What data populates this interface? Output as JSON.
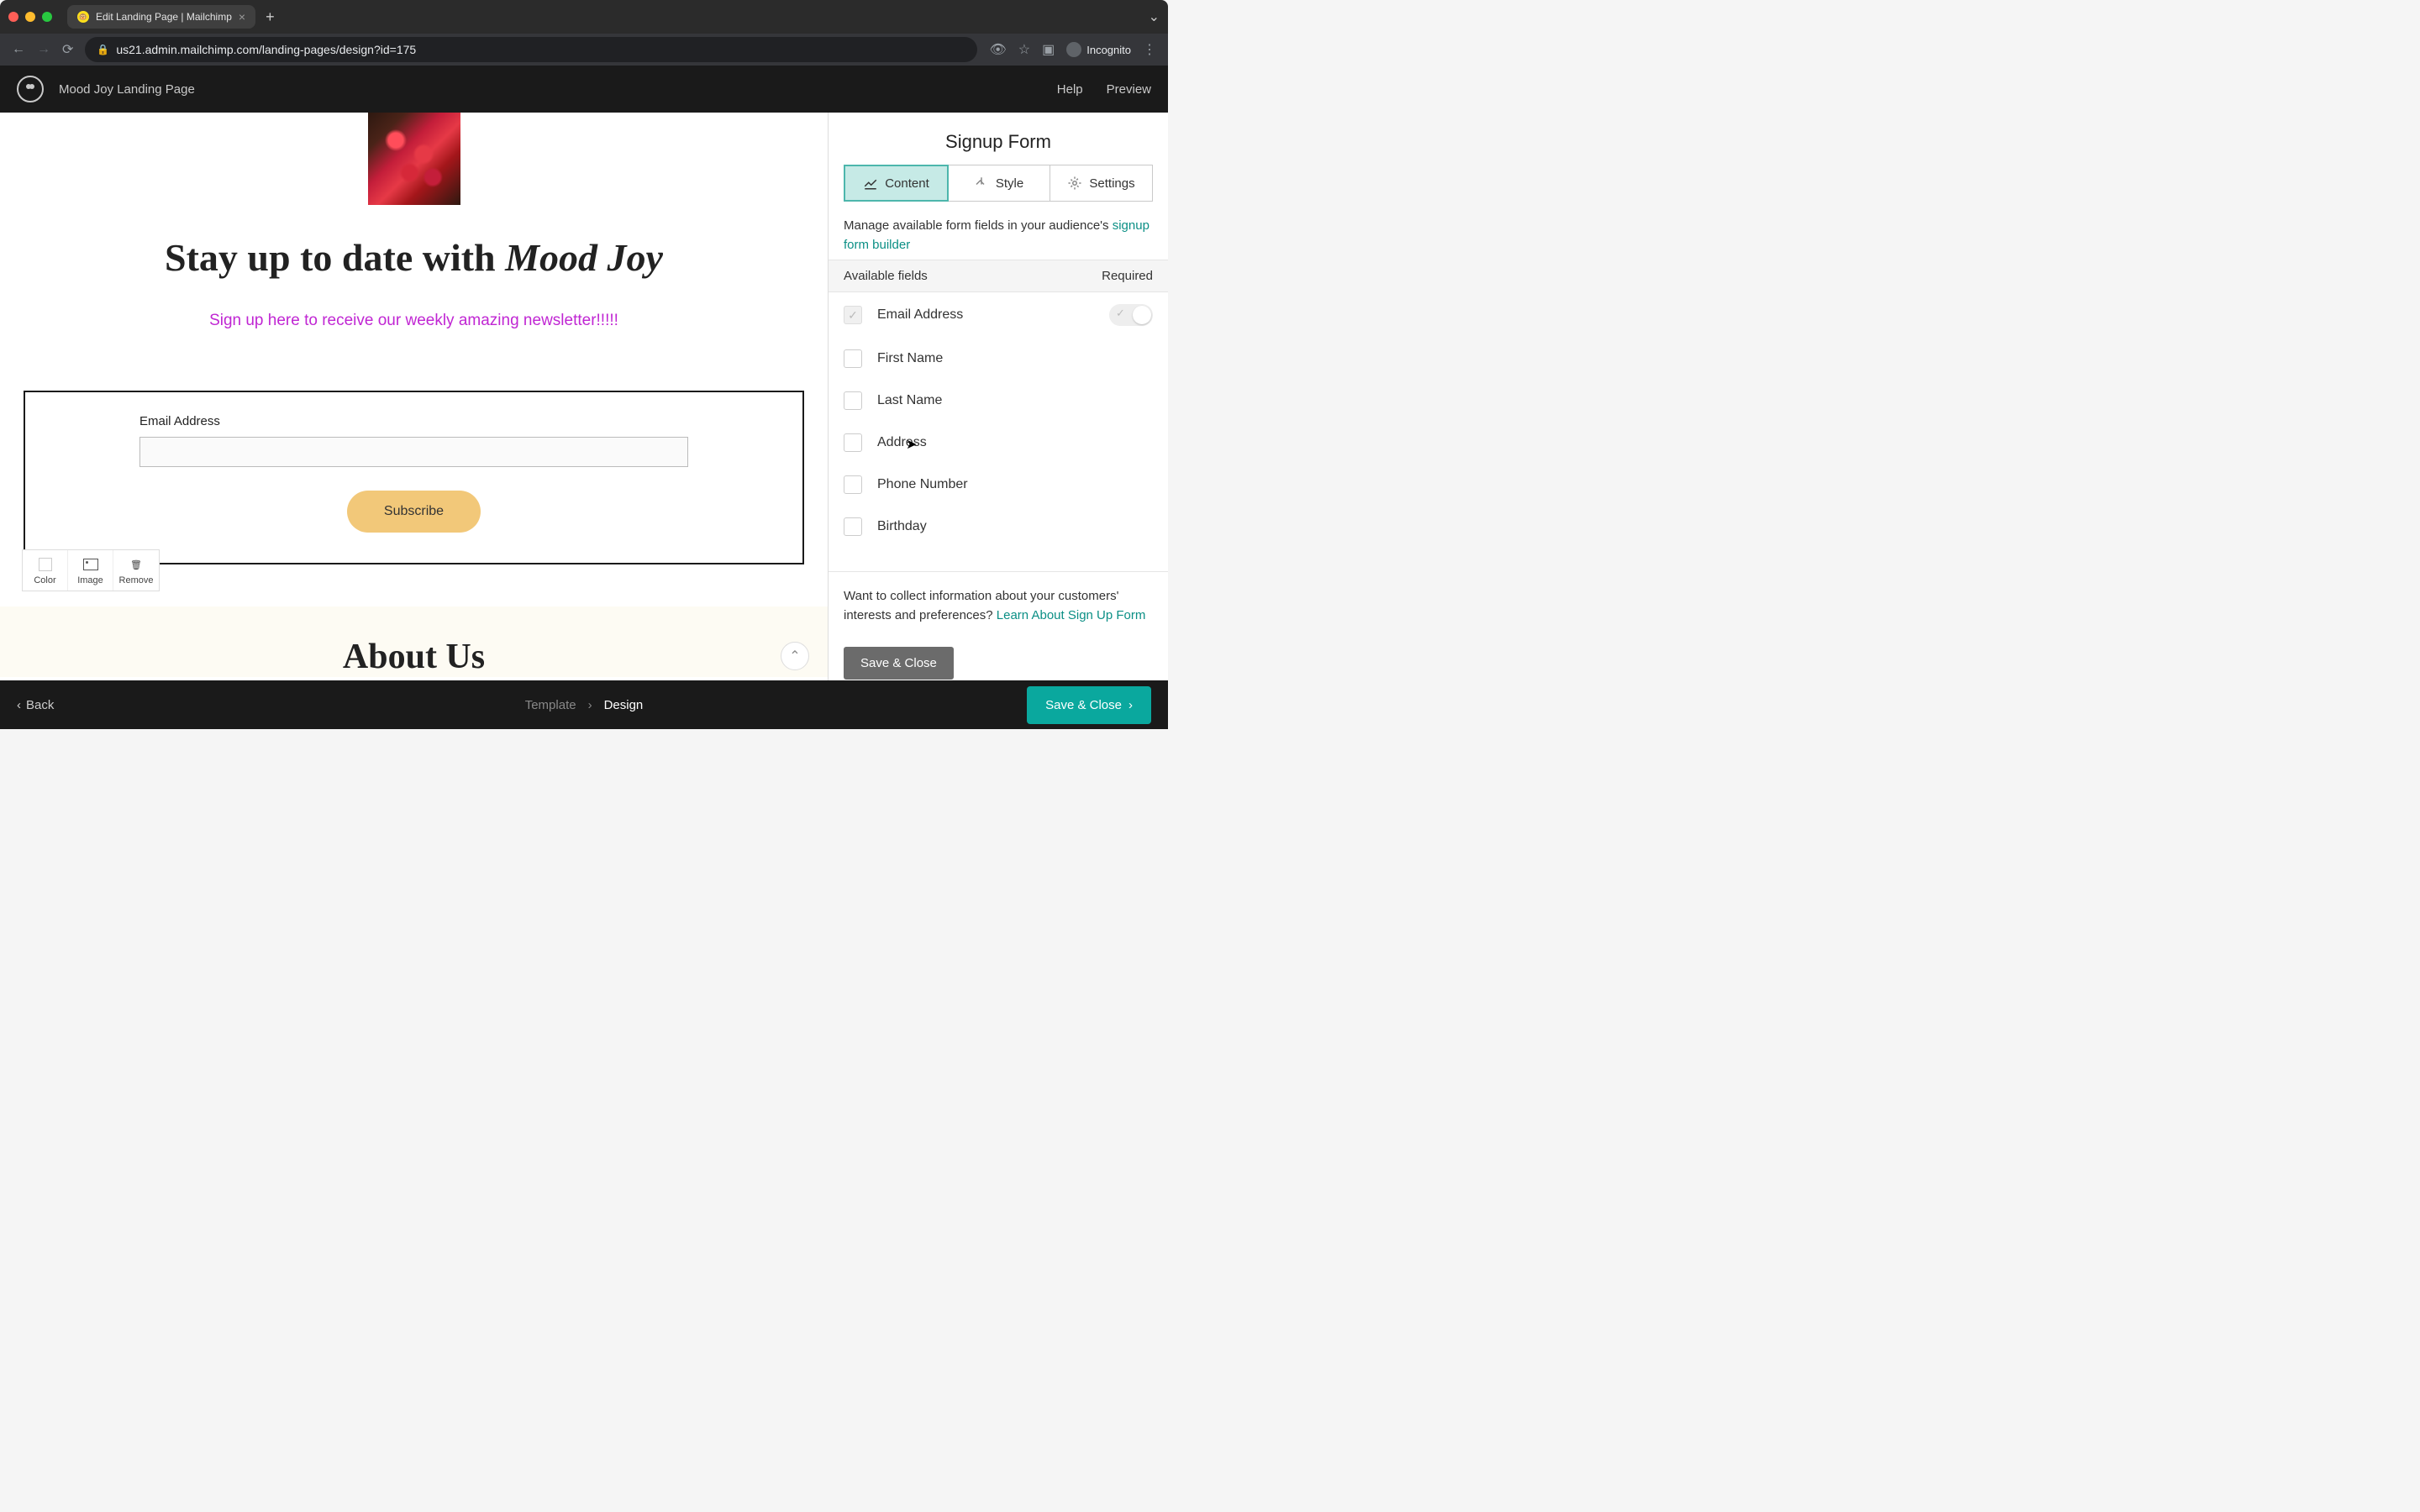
{
  "browser": {
    "tab_title": "Edit Landing Page | Mailchimp",
    "url": "us21.admin.mailchimp.com/landing-pages/design?id=175",
    "incognito_label": "Incognito"
  },
  "header": {
    "page_name": "Mood Joy Landing Page",
    "help": "Help",
    "preview": "Preview"
  },
  "canvas": {
    "headline_pre": "Stay up to date with ",
    "headline_brand": "Mood Joy",
    "subhead": "Sign up here to receive our weekly amazing newsletter!!!!!",
    "form_label": "Email Address",
    "subscribe": "Subscribe",
    "about_title": "About Us",
    "toolbar": {
      "color": "Color",
      "image": "Image",
      "remove": "Remove"
    }
  },
  "panel": {
    "title": "Signup Form",
    "tabs": {
      "content": "Content",
      "style": "Style",
      "settings": "Settings"
    },
    "manage_text": "Manage available form fields in your audience's ",
    "manage_link": "signup form builder",
    "col_available": "Available fields",
    "col_required": "Required",
    "fields": {
      "email": "Email Address",
      "first": "First Name",
      "last": "Last Name",
      "address": "Address",
      "phone": "Phone Number",
      "birthday": "Birthday"
    },
    "collect_text": "Want to collect information about your customers' interests and preferences? ",
    "collect_link": "Learn About Sign Up Form",
    "save_close": "Save & Close"
  },
  "footer": {
    "back": "Back",
    "template": "Template",
    "design": "Design",
    "save_close": "Save & Close"
  }
}
